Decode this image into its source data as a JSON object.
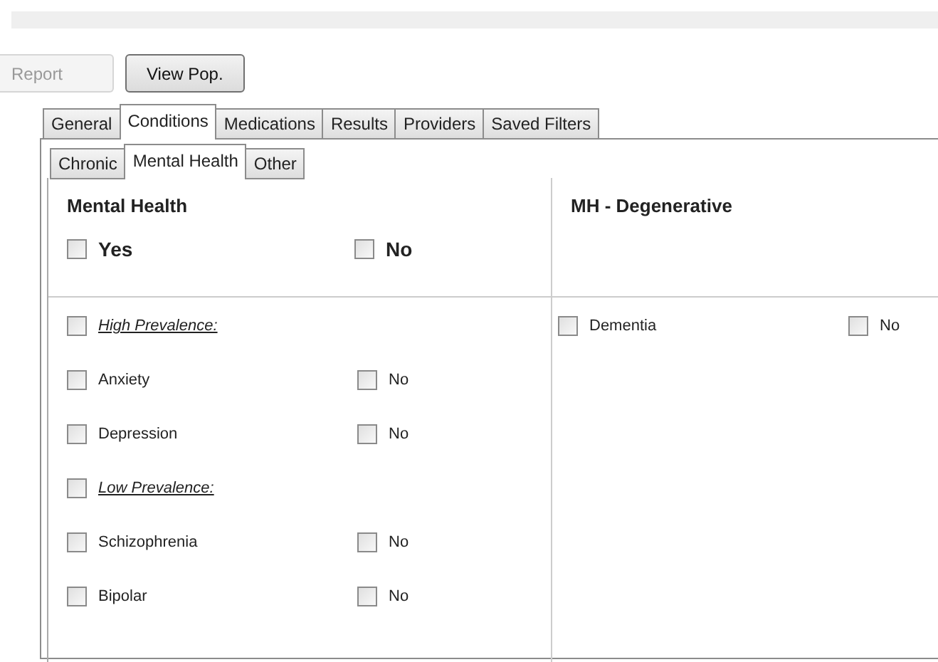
{
  "toolbar": {
    "buttons": [
      {
        "label": "Report",
        "disabled": true
      },
      {
        "label": "View Pop.",
        "disabled": false
      }
    ]
  },
  "tabs": [
    {
      "label": "General",
      "selected": false
    },
    {
      "label": "Conditions",
      "selected": true
    },
    {
      "label": "Medications",
      "selected": false
    },
    {
      "label": "Results",
      "selected": false
    },
    {
      "label": "Providers",
      "selected": false
    },
    {
      "label": "Saved Filters",
      "selected": false
    }
  ],
  "subtabs": [
    {
      "label": "Chronic",
      "selected": false
    },
    {
      "label": "Mental Health",
      "selected": true
    },
    {
      "label": "Other",
      "selected": false
    }
  ],
  "sections": [
    {
      "title": "Mental Health",
      "yes": {
        "label": "Yes",
        "checked": false
      },
      "no": {
        "label": "No",
        "checked": false
      },
      "rows": [
        {
          "kind": "category",
          "label": "High Prevalence:",
          "checked": false
        },
        {
          "kind": "condition",
          "label": "Anxiety",
          "checked": false,
          "no_label": "No",
          "no_checked": false
        },
        {
          "kind": "condition",
          "label": "Depression",
          "checked": false,
          "no_label": "No",
          "no_checked": false
        },
        {
          "kind": "category",
          "label": "Low Prevalence:",
          "checked": false
        },
        {
          "kind": "condition",
          "label": "Schizophrenia",
          "checked": false,
          "no_label": "No",
          "no_checked": false
        },
        {
          "kind": "condition",
          "label": "Bipolar",
          "checked": false,
          "no_label": "No",
          "no_checked": false
        }
      ]
    },
    {
      "title": "MH - Degenerative",
      "rows": [
        {
          "kind": "condition",
          "label": "Dementia",
          "checked": false,
          "no_label": "No",
          "no_checked": false
        }
      ]
    }
  ]
}
